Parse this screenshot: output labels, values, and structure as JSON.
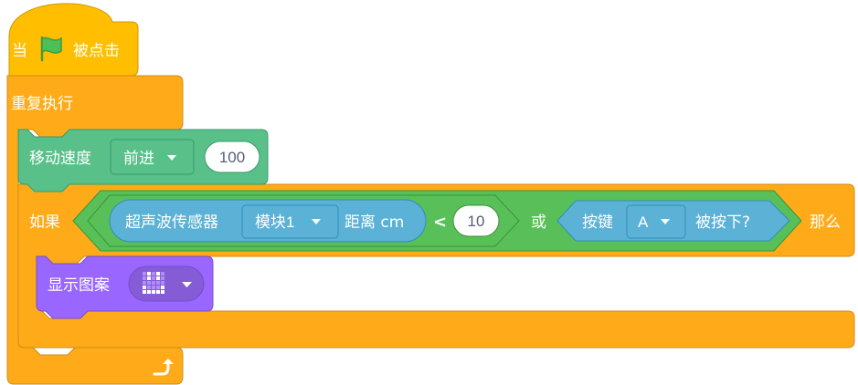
{
  "hat": {
    "prefix": "当",
    "suffix": "被点击"
  },
  "forever": {
    "label": "重复执行"
  },
  "motor": {
    "label": "移动速度",
    "direction": "前进",
    "speed": "100"
  },
  "if_block": {
    "if_label": "如果",
    "then_label": "那么",
    "ultrasonic": {
      "label": "超声波传感器",
      "module": "模块1",
      "suffix": "距离 cm"
    },
    "operator_lt": "<",
    "threshold": "10",
    "or_label": "或",
    "button": {
      "prefix": "按键",
      "key": "A",
      "suffix": "被按下?"
    }
  },
  "display": {
    "label": "显示图案"
  },
  "colors": {
    "events": "#ffbf00",
    "control": "#ffab19",
    "motion": "#59c08a",
    "sensing": "#5cb1d6",
    "operators": "#59c059",
    "looks": "#9966ff"
  }
}
